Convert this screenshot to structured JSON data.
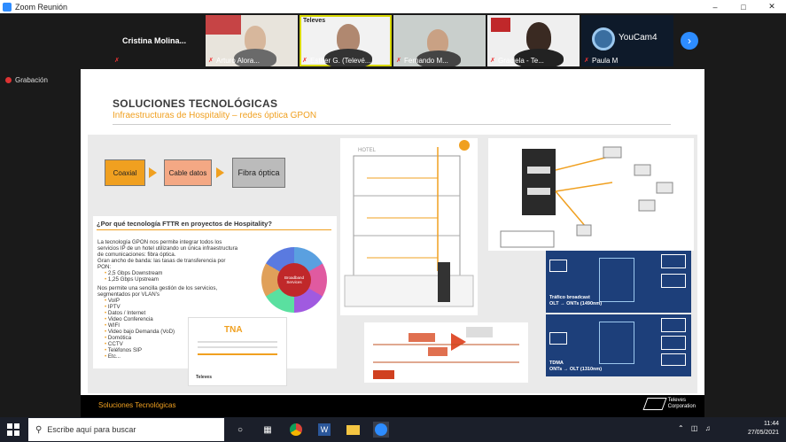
{
  "window": {
    "title": "Zoom Reunión"
  },
  "participants": [
    {
      "name": "Cristina  Molina..."
    },
    {
      "name": "Arturo Alora..."
    },
    {
      "name": "Esther G. (Televé..."
    },
    {
      "name": "Fernando M..."
    },
    {
      "name": "Graciela - Te..."
    },
    {
      "name": "Paula M"
    }
  ],
  "recording": {
    "label": "Grabación"
  },
  "slide": {
    "title": "SOLUCIONES TECNOLÓGICAS",
    "subtitle": "Infraestructuras de Hospitality – redes óptica GPON",
    "flow": [
      "Coaxial",
      "Cable datos",
      "Fibra óptica"
    ],
    "why_title": "¿Por qué tecnología FTTR en proyectos de Hospitality?",
    "why_intro": "La tecnología GPON nos permite integrar todos los servicios IP de un hotel utilizando un única infraestructura de comunicaciones: fibra óptica.",
    "why_bw": "Gran ancho de banda: las tasas de transferencia por PON:",
    "speeds": [
      "2,5 Gbps Downstream",
      "1,25 Gbps Upstream"
    ],
    "why_mgmt": "Nos permite una sencilla gestión de los servicios, segmentados por VLAN's",
    "services": [
      "VoIP",
      "IPTV",
      "Datos / Internet",
      "Video Conferencia",
      "WIFI",
      "Video bajo Demanda (VoD)",
      "Domótica",
      "CCTV",
      "Teléfonos SIP",
      "Etc..."
    ],
    "wheel_center": "Broadband Services",
    "cert_title": "TNA",
    "cert_brand": "Televes",
    "panel1_label": "Tráfico broadcast\nOLT → ONTs (1490nm)",
    "panel2_label": "TDMA\nONTs → OLT (1310nm)",
    "footer": "Soluciones Tecnológicas",
    "footer_brand": "Televes\nCorporation"
  },
  "taskbar": {
    "search_placeholder": "Escribe aquí para buscar",
    "time": "11:44",
    "date": "27/05/2021"
  },
  "colors": {
    "accent": "#f0a020",
    "zoom_blue": "#2d8cff",
    "panel_blue": "#1d3f7a"
  }
}
